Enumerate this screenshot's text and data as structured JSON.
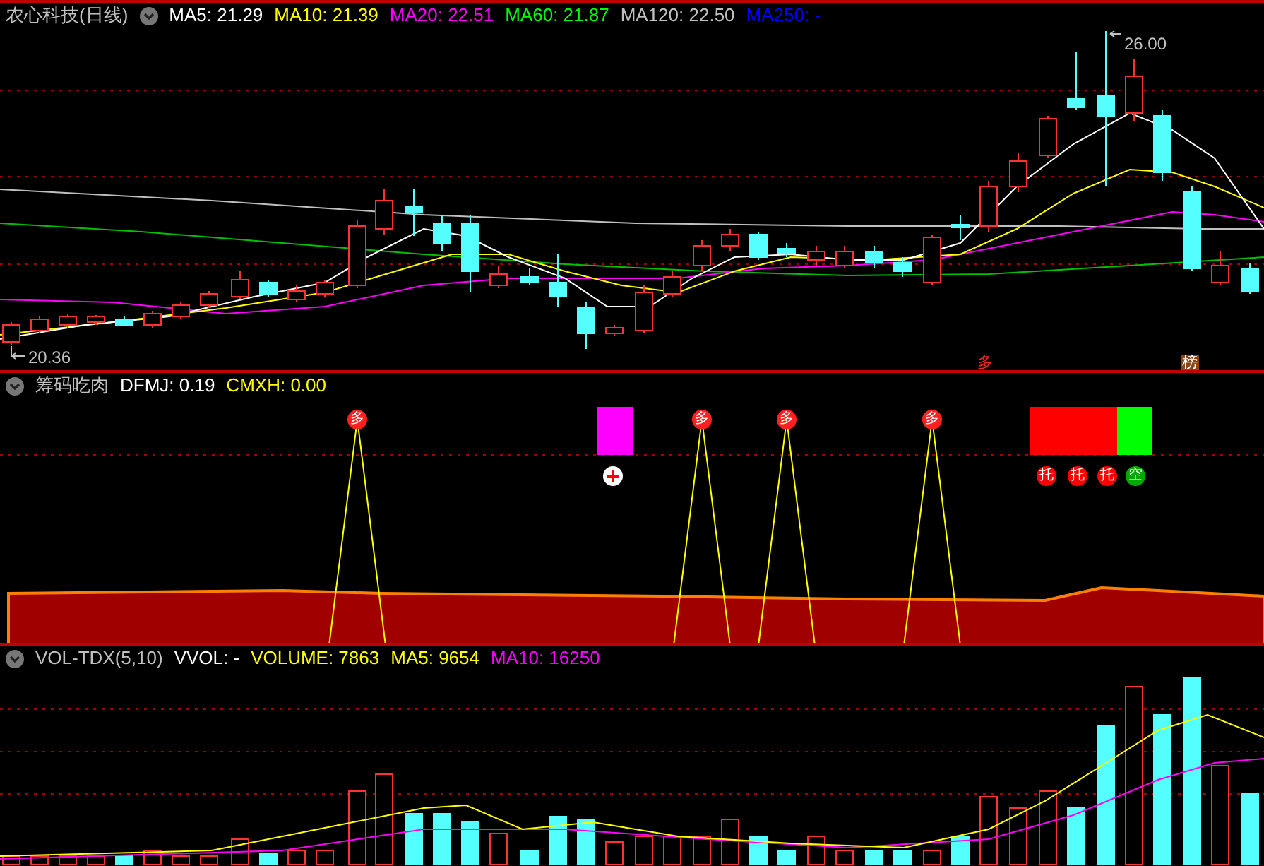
{
  "main_panel": {
    "title": "农心科技(日线)",
    "indicators": [
      {
        "label": "MA5: 21.29",
        "color": "#ffffff"
      },
      {
        "label": "MA10: 21.39",
        "color": "#ffff00"
      },
      {
        "label": "MA20: 22.51",
        "color": "#ff00ff"
      },
      {
        "label": "MA60: 21.87",
        "color": "#00ff00"
      },
      {
        "label": "MA120: 22.50",
        "color": "#c0c0c0"
      },
      {
        "label": "MA250: -",
        "color": "#0000ff"
      }
    ],
    "high_label": "26.00",
    "low_label": "20.36",
    "markers": [
      {
        "text": "多",
        "kind": "plain"
      },
      {
        "text": "榜",
        "kind": "tag"
      }
    ]
  },
  "chip_panel": {
    "title": "筹码吃肉",
    "indicators": [
      {
        "label": "DFMJ: 0.19",
        "color": "#ffffff"
      },
      {
        "label": "CMXH: 0.00",
        "color": "#ffff00"
      }
    ],
    "peak_signals": [
      "多",
      "多",
      "多",
      "多"
    ],
    "signals": [
      {
        "text": "托",
        "color": "#ff0000"
      },
      {
        "text": "托",
        "color": "#ff0000"
      },
      {
        "text": "托",
        "color": "#ff0000"
      },
      {
        "text": "空",
        "color": "#00aa00"
      }
    ]
  },
  "volume_panel": {
    "title": "VOL-TDX(5,10)",
    "indicators": [
      {
        "label": "VVOL: -",
        "color": "#ffffff"
      },
      {
        "label": "VOLUME: 7863",
        "color": "#ffff00"
      },
      {
        "label": "MA5: 9654",
        "color": "#ffff00"
      },
      {
        "label": "MA10: 16250",
        "color": "#ff00ff"
      }
    ]
  }
}
